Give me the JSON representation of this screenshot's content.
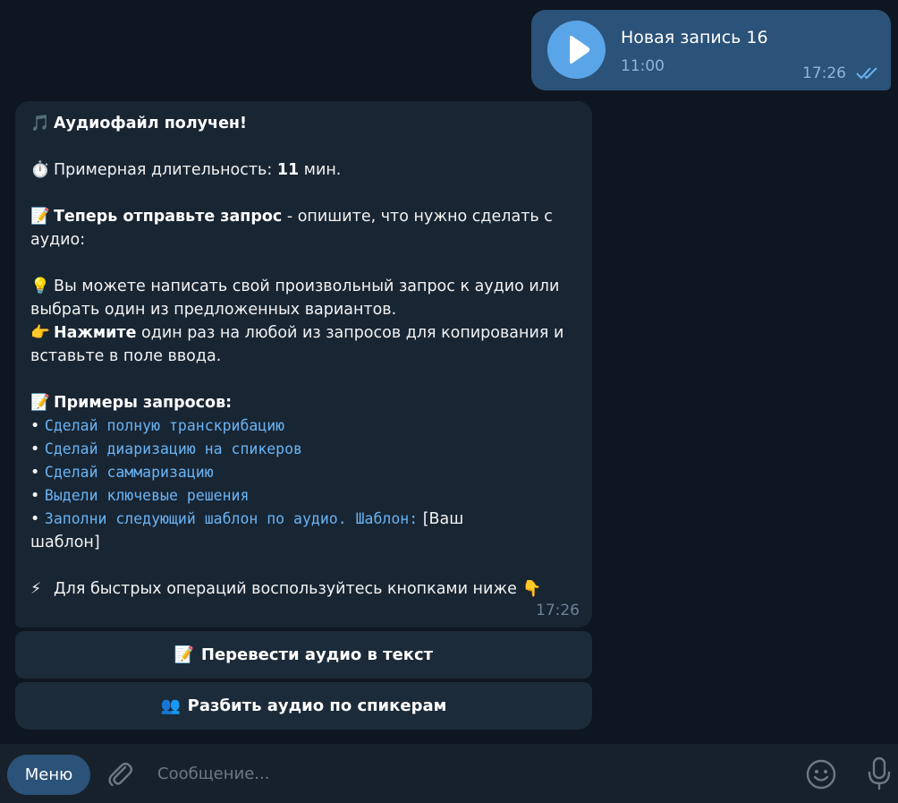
{
  "outgoing": {
    "voice_title": "Новая запись 16",
    "voice_duration": "11:00",
    "time": "17:26",
    "status_icon": "double-check-icon"
  },
  "incoming": {
    "header": "Аудиофайл получен!",
    "duration_label": "Примерная длительность:",
    "duration_value": "11",
    "duration_unit": "мин.",
    "request_bold": "Теперь отправьте запрос",
    "request_rest": " - опишите, что нужно сделать с",
    "request_line2": "аудио:",
    "hint_line1": "Вы можете написать свой произвольный запрос к аудио или",
    "hint_line2": "выбрать один из предложенных вариантов.",
    "press_bold": "Нажмите",
    "press_rest": " один раз на любой из запросов для копирования и",
    "press_line2": "вставьте в поле ввода.",
    "examples_title": "Примеры запросов:",
    "examples": [
      "Сделай полную транскрибацию",
      "Сделай диаризацию на спикеров",
      "Сделай саммаризацию",
      "Выдели ключевые решения",
      "Заполни следующий шаблон по аудио. Шаблон:"
    ],
    "template_suffix": " [Ваш",
    "template_line2": "шаблон]",
    "quick_ops": "Для быстрых операций воспользуйтесь кнопками ниже",
    "time": "17:26",
    "emoji": {
      "note": "🎵",
      "stopwatch": "⏱️",
      "memo": "📝",
      "bulb": "💡",
      "point_right": "👉",
      "bolt": "⚡",
      "point_down": "👇",
      "bullet": "•"
    }
  },
  "keyboard": [
    {
      "emoji": "📝",
      "label": "Перевести аудио в текст"
    },
    {
      "emoji": "👥",
      "label": "Разбить аудио по спикерам"
    }
  ],
  "composer": {
    "menu_label": "Меню",
    "placeholder": "Сообщение..."
  },
  "colors": {
    "background": "#0e1621",
    "outgoing_bubble": "#2b5278",
    "incoming_bubble": "#182533",
    "accent": "#5aa5e8",
    "link": "#6ab3f3"
  }
}
